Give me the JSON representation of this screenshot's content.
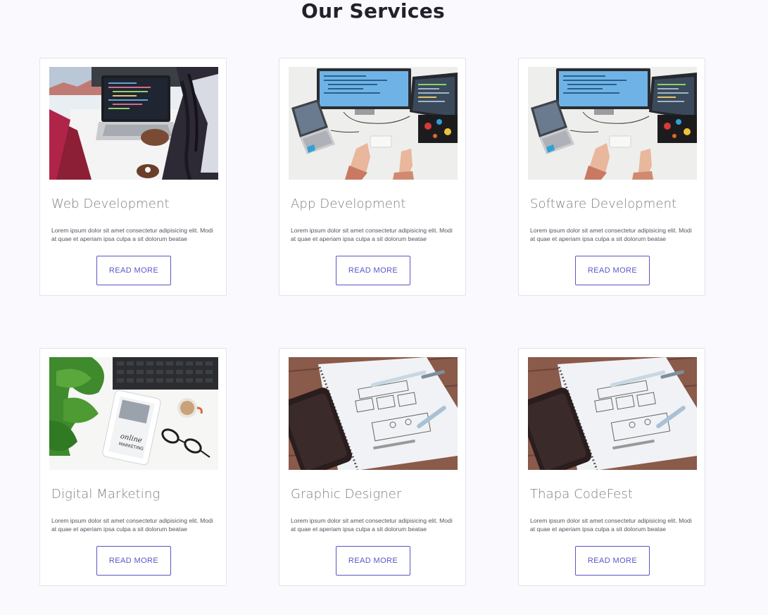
{
  "section": {
    "title": "Our Services"
  },
  "cards": [
    {
      "image": "laptop-coding-photo",
      "title": "Web Development",
      "text": "Lorem ipsum dolor sit amet consectetur adipisicing elit. Modi at quae et aperiam ipsa culpa a sit dolorum beatae",
      "button_label": "READ MORE"
    },
    {
      "image": "desk-monitors-photo",
      "title": "App Development",
      "text": "Lorem ipsum dolor sit amet consectetur adipisicing elit. Modi at quae et aperiam ipsa culpa a sit dolorum beatae",
      "button_label": "READ MORE"
    },
    {
      "image": "desk-monitors-photo",
      "title": "Software Development",
      "text": "Lorem ipsum dolor sit amet consectetur adipisicing elit. Modi at quae et aperiam ipsa culpa a sit dolorum beatae",
      "button_label": "READ MORE"
    },
    {
      "image": "tablet-marketing-photo",
      "title": "Digital Marketing",
      "text": "Lorem ipsum dolor sit amet consectetur adipisicing elit. Modi at quae et aperiam ipsa culpa a sit dolorum beatae",
      "button_label": "READ MORE"
    },
    {
      "image": "wireframe-sketch-photo",
      "title": "Graphic Designer",
      "text": "Lorem ipsum dolor sit amet consectetur adipisicing elit. Modi at quae et aperiam ipsa culpa a sit dolorum beatae",
      "button_label": "READ MORE"
    },
    {
      "image": "wireframe-sketch-photo",
      "title": "Thapa CodeFest",
      "text": "Lorem ipsum dolor sit amet consectetur adipisicing elit. Modi at quae et aperiam ipsa culpa a sit dolorum beatae",
      "button_label": "READ MORE"
    }
  ],
  "colors": {
    "background": "#f9f9fe",
    "heading": "#21212b",
    "card_title": "#7f7f85",
    "accent": "#5a56c8",
    "card_border": "#e3e3e8"
  }
}
